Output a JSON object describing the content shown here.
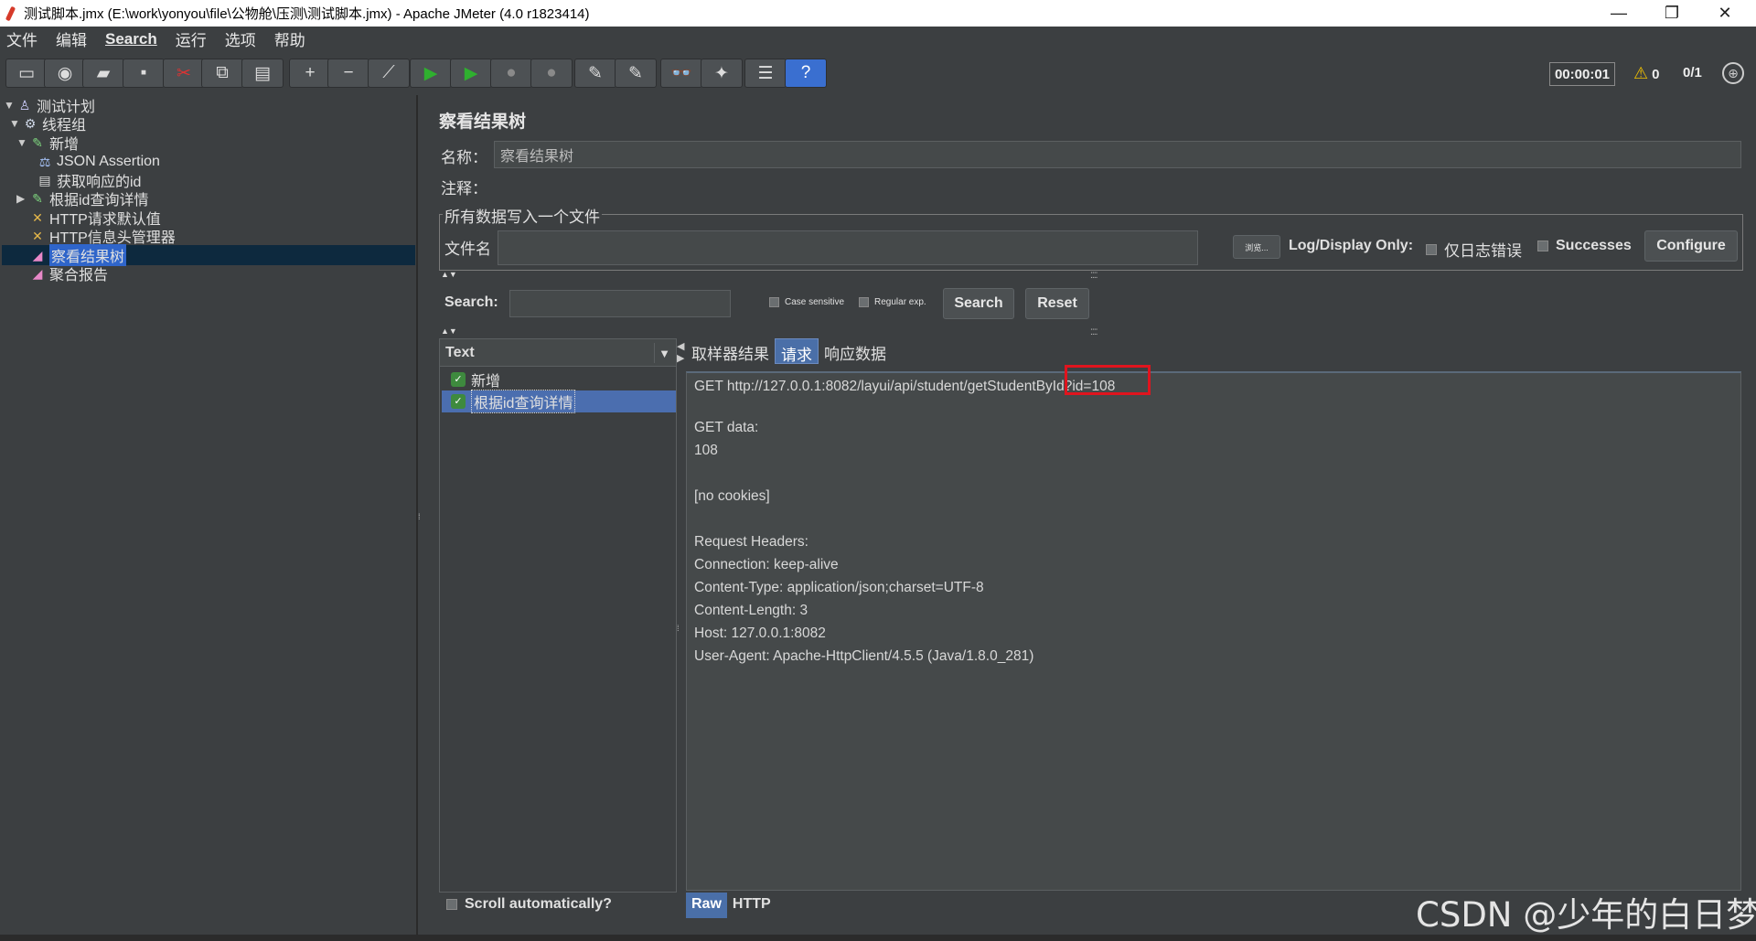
{
  "window": {
    "title": "测试脚本.jmx (E:\\work\\yonyou\\file\\公物舱\\压测\\测试脚本.jmx) - Apache JMeter (4.0 r1823414)",
    "controls": {
      "minimize": "—",
      "restore": "❐",
      "close": "✕"
    }
  },
  "menu": {
    "items": [
      "文件",
      "编辑",
      "Search",
      "运行",
      "选项",
      "帮助"
    ]
  },
  "toolbar": {
    "buttons": [
      {
        "name": "new-button",
        "glyph": "▭"
      },
      {
        "name": "templates-button",
        "glyph": "◉"
      },
      {
        "name": "open-button",
        "glyph": "▰"
      },
      {
        "name": "save-button",
        "glyph": "▪"
      },
      {
        "name": "cut-button",
        "glyph": "✂"
      },
      {
        "name": "copy-button",
        "glyph": "⧉"
      },
      {
        "name": "paste-button",
        "glyph": "▤"
      },
      {
        "name": "expand-button",
        "glyph": "+"
      },
      {
        "name": "collapse-button",
        "glyph": "−"
      },
      {
        "name": "toggle-button",
        "glyph": "⟋"
      },
      {
        "name": "start-button",
        "glyph": "▶"
      },
      {
        "name": "start-no-pause-button",
        "glyph": "▶"
      },
      {
        "name": "stop-button",
        "glyph": "●"
      },
      {
        "name": "shutdown-button",
        "glyph": "●"
      },
      {
        "name": "clear-button",
        "glyph": "✎"
      },
      {
        "name": "clear-all-button",
        "glyph": "✎"
      },
      {
        "name": "search-button",
        "glyph": "👓"
      },
      {
        "name": "reset-search-button",
        "glyph": "✦"
      },
      {
        "name": "function-helper-button",
        "glyph": "☰"
      },
      {
        "name": "help-button",
        "glyph": "?"
      }
    ],
    "elapsed_time": "00:00:01",
    "warnings": "0",
    "threads": "0/1",
    "colors": {
      "start": "#2fb02f",
      "stop": "#8a8a8a",
      "help": "#3a6fd0",
      "cut": "#d33",
      "warning": "#f0c000"
    }
  },
  "tree": {
    "nodes": [
      {
        "label": "测试计划",
        "icon": "test-plan-icon",
        "toggle": "▼"
      },
      {
        "label": "线程组",
        "icon": "thread-group-icon",
        "toggle": "▼"
      },
      {
        "label": "新增",
        "icon": "http-sampler-icon",
        "toggle": "▼"
      },
      {
        "label": "JSON Assertion",
        "icon": "assertion-icon",
        "toggle": ""
      },
      {
        "label": "获取响应的id",
        "icon": "post-processor-icon",
        "toggle": ""
      },
      {
        "label": "根据id查询详情",
        "icon": "http-sampler-icon",
        "toggle": "▶"
      },
      {
        "label": "HTTP请求默认值",
        "icon": "config-element-icon",
        "toggle": ""
      },
      {
        "label": "HTTP信息头管理器",
        "icon": "config-element-icon",
        "toggle": ""
      },
      {
        "label": "察看结果树",
        "icon": "listener-icon",
        "toggle": ""
      },
      {
        "label": "聚合报告",
        "icon": "listener-icon",
        "toggle": ""
      }
    ]
  },
  "panel": {
    "title": "察看结果树",
    "name_label": "名称：",
    "name_value": "察看结果树",
    "comment_label": "注释：",
    "comment_value": "",
    "file_group_label": "所有数据写入一个文件",
    "filename_label": "文件名",
    "filename_value": "",
    "browse_label": "浏览...",
    "log_display_label": "Log/Display Only:",
    "errors_only_label": "仅日志错误",
    "successes_label": "Successes",
    "configure_label": "Configure",
    "search_label": "Search:",
    "search_value": "",
    "case_sensitive_label": "Case sensitive",
    "regex_label": "Regular exp.",
    "search_button": "Search",
    "reset_button": "Reset",
    "renderer": "Text",
    "results": [
      {
        "label": "新增",
        "status": "success"
      },
      {
        "label": "根据id查询详情",
        "status": "success"
      }
    ],
    "tabs": [
      "取样器结果",
      "请求",
      "响应数据"
    ],
    "active_tab": "请求",
    "request_lines": [
      "GET http://127.0.0.1:8082/layui/api/student/getStudentById?id=108",
      "",
      "GET data:",
      "108",
      "",
      "[no cookies]",
      "",
      "Request Headers:",
      "Connection: keep-alive",
      "Content-Type: application/json;charset=UTF-8",
      "Content-Length: 3",
      "Host: 127.0.0.1:8082",
      "User-Agent: Apache-HttpClient/4.5.5 (Java/1.8.0_281)"
    ],
    "bottom_tabs": [
      "Raw",
      "HTTP"
    ],
    "scroll_auto_label": "Scroll automatically?",
    "highlight_color": "#e0141e"
  },
  "watermark": "CSDN @少年的白日梦"
}
